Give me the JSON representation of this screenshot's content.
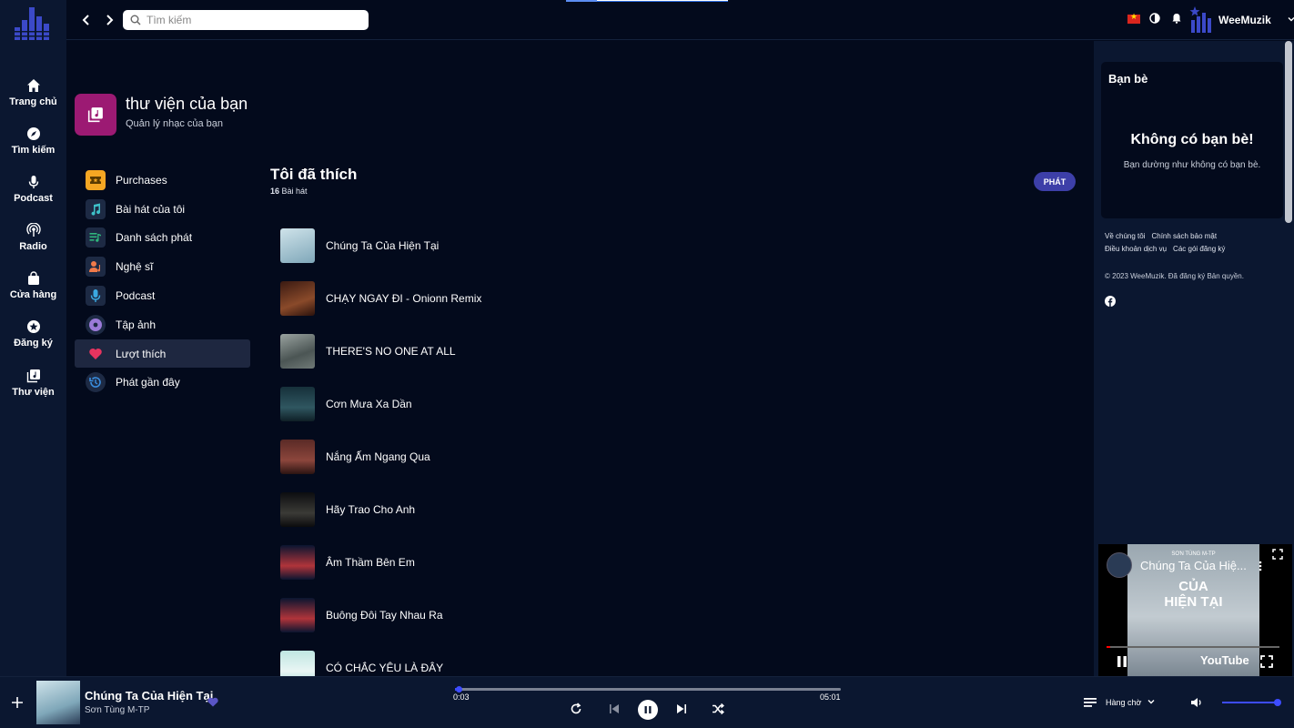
{
  "nav": {
    "items": [
      {
        "label": "Trang chủ",
        "icon": "home-icon"
      },
      {
        "label": "Tìm kiếm",
        "icon": "compass-icon"
      },
      {
        "label": "Podcast",
        "icon": "microphone-icon"
      },
      {
        "label": "Radio",
        "icon": "radio-icon"
      },
      {
        "label": "Cửa hàng",
        "icon": "shopping-bag-icon"
      },
      {
        "label": "Đăng ký",
        "icon": "star-badge-icon"
      },
      {
        "label": "Thư viện",
        "icon": "library-icon"
      }
    ]
  },
  "search": {
    "placeholder": "Tìm kiếm"
  },
  "user": {
    "name": "WeeMuzik"
  },
  "library": {
    "title": "thư viện của bạn",
    "subtitle": "Quản lý nhạc của bạn",
    "categories": [
      {
        "label": "Purchases",
        "icon": "ticket-icon",
        "color": "#f5a623"
      },
      {
        "label": "Bài hát của tôi",
        "icon": "music-note-icon",
        "color": "#3ec1c9"
      },
      {
        "label": "Danh sách phát",
        "icon": "playlist-icon",
        "color": "#2fb67c"
      },
      {
        "label": "Nghệ sĩ",
        "icon": "artist-icon",
        "color": "#f07a4a"
      },
      {
        "label": "Podcast",
        "icon": "microphone-icon",
        "color": "#3aa8e0"
      },
      {
        "label": "Tập ảnh",
        "icon": "album-icon",
        "color": "#9b7ad8"
      },
      {
        "label": "Lượt thích",
        "icon": "heart-icon",
        "color": "#e8345f"
      },
      {
        "label": "Phát gần đây",
        "icon": "history-icon",
        "color": "#3a8ee0"
      }
    ]
  },
  "liked": {
    "title": "Tôi đã thích",
    "count": "16",
    "count_unit": "Bài hát",
    "play_label": "PHÁT",
    "songs": [
      "Chúng Ta Của Hiện Tại",
      "CHẠY NGAY ĐI - Onionn Remix",
      "THERE'S NO ONE AT ALL",
      "Cơn Mưa Xa Dần",
      "Nắng Ấm Ngang Qua",
      "Hãy Trao Cho Anh",
      "Âm Thầm Bên Em",
      "Buông Đôi Tay Nhau Ra",
      "CÓ CHẮC YÊU LÀ ĐÂY"
    ]
  },
  "friends": {
    "title": "Bạn bè",
    "empty_title": "Không có bạn bè!",
    "empty_desc": "Bạn dường như không có bạn bè."
  },
  "footer": {
    "links_row1": [
      "Về chúng tôi",
      "Chính sách bảo mật"
    ],
    "links_row2": [
      "Điều khoản dịch vụ",
      "Các gói đăng ký"
    ],
    "copyright": "© 2023 WeeMuzik. Đã đăng ký Bản quyền."
  },
  "video": {
    "title": "Chúng Ta Của Hiệ...",
    "artist_caption": "SƠN TÙNG M-TP",
    "big_title_line1": "CỦA",
    "big_title_line2": "HIỆN TẠI",
    "brand": "YouTube"
  },
  "player": {
    "title": "Chúng Ta Của Hiện Tại",
    "artist": "Sơn Tùng M-TP",
    "current_time": "0:03",
    "duration": "05:01",
    "progress_fraction": 0.01,
    "queue_label": "Hàng chờ",
    "volume_fraction": 0.95
  },
  "colors": {
    "accent": "#3d4cff",
    "play_button": "#3d3fa8",
    "library_icon": "#9c1a73",
    "sidebar_bg": "#0b1730",
    "main_bg": "#030a1c"
  }
}
